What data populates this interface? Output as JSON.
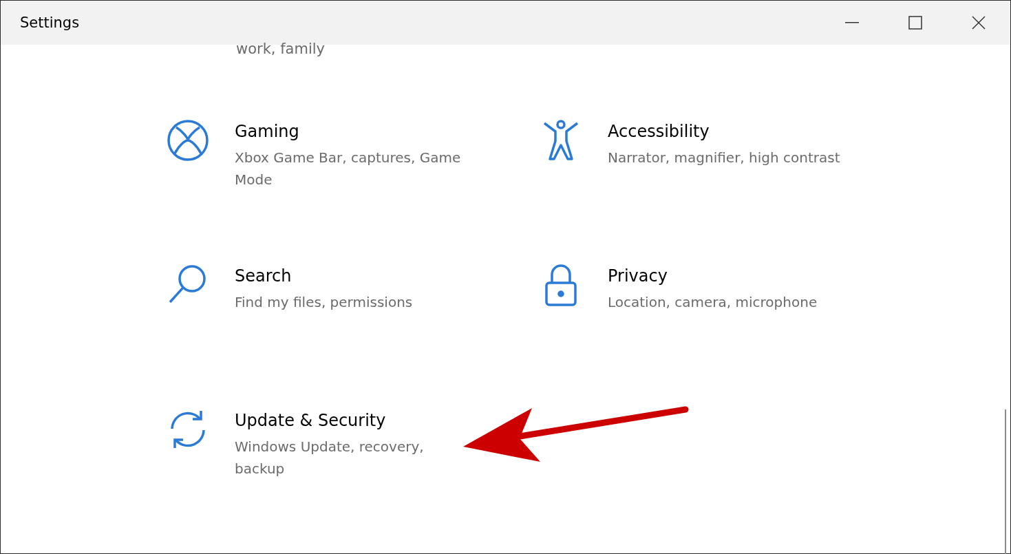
{
  "window": {
    "title": "Settings"
  },
  "partial_description": "work, family",
  "categories": [
    {
      "title": "Gaming",
      "description": "Xbox Game Bar, captures, Game Mode"
    },
    {
      "title": "Accessibility",
      "description": "Narrator, magnifier, high contrast"
    },
    {
      "title": "Search",
      "description": "Find my files, permissions"
    },
    {
      "title": "Privacy",
      "description": "Location, camera, microphone"
    },
    {
      "title": "Update & Security",
      "description": "Windows Update, recovery, backup"
    }
  ]
}
